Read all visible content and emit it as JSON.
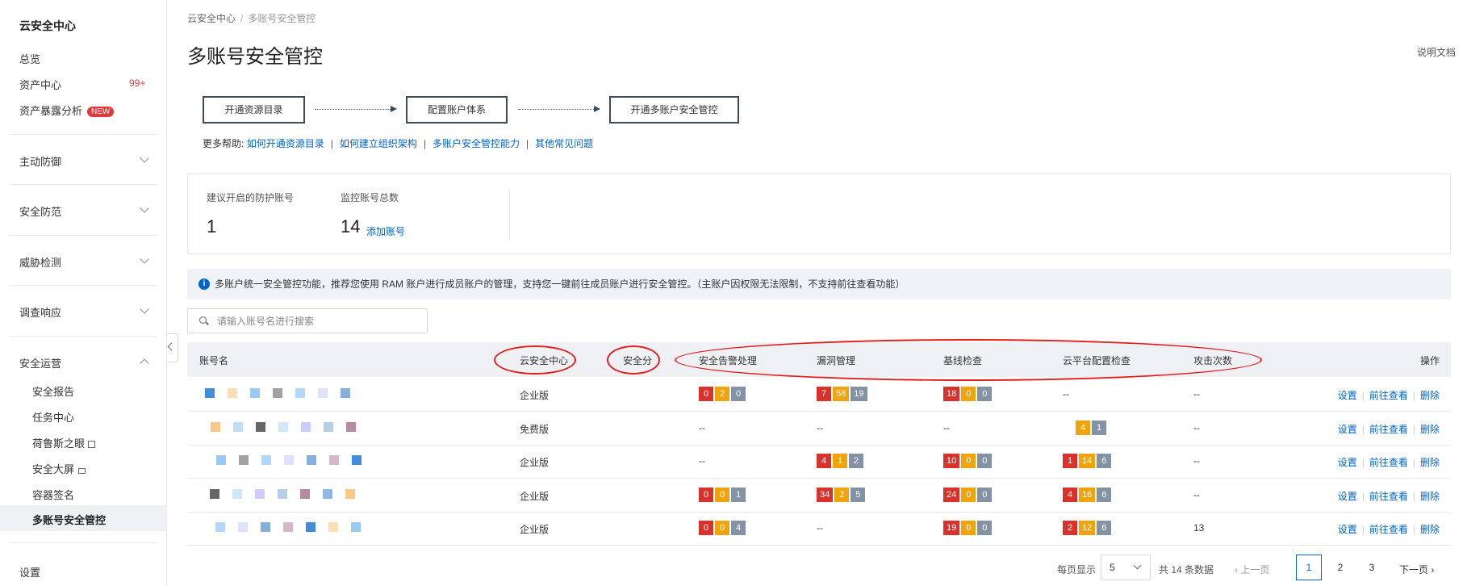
{
  "sidebar": {
    "title": "云安全中心",
    "items": {
      "overview": "总览",
      "assets": "资产中心",
      "assets_badge": "99+",
      "exposure": "资产暴露分析",
      "exposure_badge": "NEW"
    },
    "groups": [
      "主动防御",
      "安全防范",
      "威胁检测",
      "调查响应"
    ],
    "ops_group": "安全运营",
    "ops_items": [
      "安全报告",
      "任务中心",
      "荷鲁斯之眼",
      "安全大屏",
      "容器签名",
      "多账号安全管控"
    ],
    "settings": "设置"
  },
  "breadcrumb": {
    "root": "云安全中心",
    "sep": "/",
    "current": "多账号安全管控"
  },
  "page_title": "多账号安全管控",
  "doc_link": "说明文档",
  "steps": [
    "开通资源目录",
    "配置账户体系",
    "开通多账户安全管控"
  ],
  "help": {
    "prefix": "更多帮助:",
    "links": [
      "如何开通资源目录",
      "如何建立组织架构",
      "多账户安全管控能力",
      "其他常见问题"
    ],
    "bar": "|"
  },
  "stats": {
    "recommended_label": "建议开启的防护账号",
    "recommended_value": "1",
    "monitored_label": "监控账号总数",
    "monitored_value": "14",
    "add_link": "添加账号"
  },
  "notice": {
    "icon": "i",
    "text": "多账户统一安全管控功能，推荐您使用 RAM 账户进行成员账户的管理，支持您一键前往成员账户进行安全管控。（主账户因权限无法限制，不支持前往查看功能）"
  },
  "search": {
    "placeholder": "请输入账号名进行搜索"
  },
  "table": {
    "headers": {
      "name": "账号名",
      "edition": "云安全中心",
      "score": "安全分",
      "alerts": "安全告警处理",
      "vuln": "漏洞管理",
      "baseline": "基线检查",
      "cloud": "云平台配置检查",
      "attacks": "攻击次数",
      "ops": "操作"
    },
    "rows": [
      {
        "edition": "企业版",
        "alerts": [
          "0",
          "2",
          "0"
        ],
        "vuln": [
          "7",
          "58",
          "19"
        ],
        "baseline": [
          "18",
          "0",
          "0"
        ],
        "cloud_text": "--",
        "attacks": "--"
      },
      {
        "edition": "免费版",
        "alerts_text": "--",
        "vuln_text": "--",
        "baseline_text": "--",
        "cloud": [
          "4",
          "1"
        ],
        "attacks": "--"
      },
      {
        "edition": "企业版",
        "alerts_text": "--",
        "vuln": [
          "4",
          "1",
          "2"
        ],
        "baseline": [
          "10",
          "0",
          "0"
        ],
        "cloud": [
          "1",
          "14",
          "6"
        ],
        "attacks": "--"
      },
      {
        "edition": "企业版",
        "alerts": [
          "0",
          "0",
          "1"
        ],
        "vuln": [
          "34",
          "2",
          "5"
        ],
        "baseline": [
          "24",
          "0",
          "0"
        ],
        "cloud": [
          "4",
          "16",
          "6"
        ],
        "attacks": "--"
      },
      {
        "edition": "企业版",
        "alerts": [
          "0",
          "0",
          "4"
        ],
        "vuln_text": "--",
        "baseline": [
          "19",
          "0",
          "0"
        ],
        "cloud": [
          "2",
          "12",
          "6"
        ],
        "attacks": "13"
      }
    ],
    "ops": {
      "settings": "设置",
      "goto": "前往查看",
      "delete": "删除",
      "bar": "|"
    }
  },
  "pagination": {
    "per_page_label": "每页显示",
    "per_page_value": "5",
    "total": "共 14 条数据",
    "prev": "上一页",
    "pages": [
      "1",
      "2",
      "3"
    ],
    "next": "下一页"
  },
  "colors": {
    "red": "#d9312b",
    "orange": "#f0a30a",
    "gray": "#8492a6",
    "link": "#0064c8",
    "annotation": "#e0201e"
  }
}
